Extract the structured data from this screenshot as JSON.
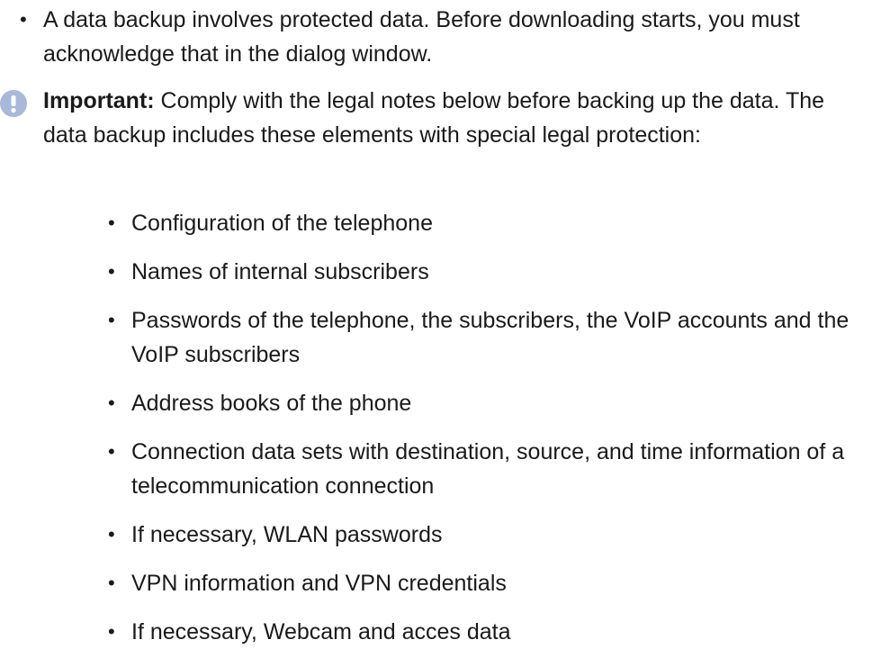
{
  "top_bullet": {
    "bullet": "•",
    "text": "A data backup involves protected data. Before downloading starts, you must acknowledge that in the dialog window."
  },
  "important": {
    "icon": "exclamation-icon",
    "icon_color": "#a8b8d8",
    "label": "Important:",
    "text": " Comply with the legal notes below before backing up the data. The data backup includes these elements with special legal protection:"
  },
  "protected_elements": [
    {
      "bullet": "•",
      "text": "Configuration of the telephone"
    },
    {
      "bullet": "•",
      "text": "Names of internal subscribers"
    },
    {
      "bullet": "•",
      "text": "Passwords of the telephone, the subscribers, the VoIP accounts and the VoIP subscribers"
    },
    {
      "bullet": "•",
      "text": "Address books of the phone"
    },
    {
      "bullet": "•",
      "text": "Connection data sets with destination, source, and time information of a telecommunication connection"
    },
    {
      "bullet": "•",
      "text": "If necessary, WLAN passwords"
    },
    {
      "bullet": "•",
      "text": "VPN information and VPN credentials"
    },
    {
      "bullet": "•",
      "text": "If necessary, Webcam and acces data"
    }
  ]
}
